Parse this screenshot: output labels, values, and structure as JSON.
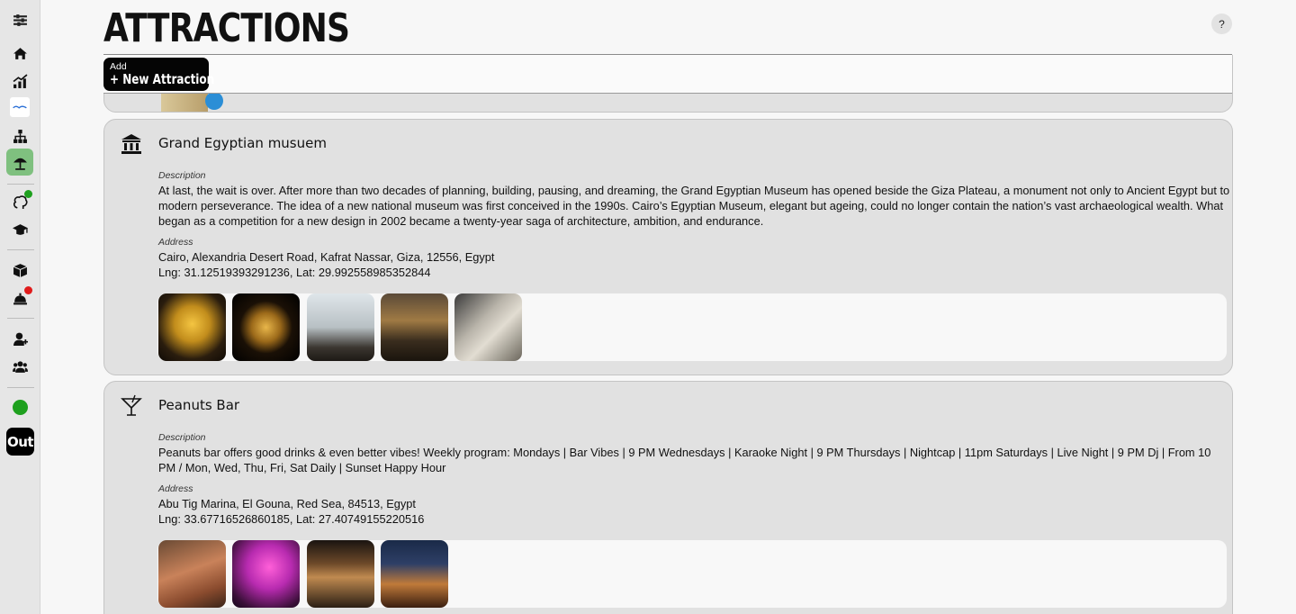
{
  "page": {
    "title": "ATTRACTIONS",
    "help_label": "?"
  },
  "add_button": {
    "small_label": "Add",
    "main_label": "+ New Attraction"
  },
  "sidebar": {
    "items": [
      {
        "icon": "sliders-icon"
      },
      {
        "icon": "home-icon"
      },
      {
        "icon": "chart-icon"
      },
      {
        "icon": "logo-icon"
      },
      {
        "icon": "hierarchy-icon"
      },
      {
        "icon": "beach-umbrella-icon",
        "active": true
      },
      {
        "icon": "brain-icon",
        "badge_color": "#1ea01e"
      },
      {
        "icon": "graduation-cap-icon"
      },
      {
        "icon": "box-icon"
      },
      {
        "icon": "service-bell-icon",
        "badge_color": "#e01b1b"
      },
      {
        "icon": "user-icon"
      },
      {
        "icon": "users-icon"
      }
    ],
    "status_color": "#1ea01e",
    "logout_label": "Out"
  },
  "attractions": [
    {
      "icon": "museum-icon",
      "name": "Grand Egyptian musuem",
      "description_label": "Description",
      "description": "At last, the wait is over. After more than two decades of planning, building, pausing, and dreaming, the Grand Egyptian Museum has opened beside the Giza Plateau, a monument not only to Ancient Egypt but to modern perseverance.  The idea of a new national museum was first conceived in the 1990s. Cairo’s Egyptian Museum, elegant but ageing, could no longer contain the nation’s vast archaeological wealth. What began as a competition for a new design in 2002 became a twenty-year saga of architecture, ambition, and endurance.",
      "address_label": "Address",
      "address": "Cairo, Alexandria Desert Road, Kafrat Nassar, Giza, 12556, Egypt",
      "coords": "Lng: 31.12519393291236, Lat: 29.992558985352844",
      "photos": 5
    },
    {
      "icon": "cocktail-icon",
      "name": "Peanuts Bar",
      "description_label": "Description",
      "description": "Peanuts bar offers good drinks & even better vibes! Weekly program: Mondays | Bar Vibes | 9 PM Wednesdays | Karaoke Night | 9 PM Thursdays | Nightcap | 11pm Saturdays | Live Night | 9 PM Dj | From 10 PM / Mon, Wed, Thu, Fri, Sat Daily | Sunset Happy Hour",
      "address_label": "Address",
      "address": "Abu Tig Marina, El Gouna, Red Sea, 84513, Egypt",
      "coords": "Lng: 33.67716526860185, Lat: 27.40749155220516",
      "photos": 4
    }
  ]
}
